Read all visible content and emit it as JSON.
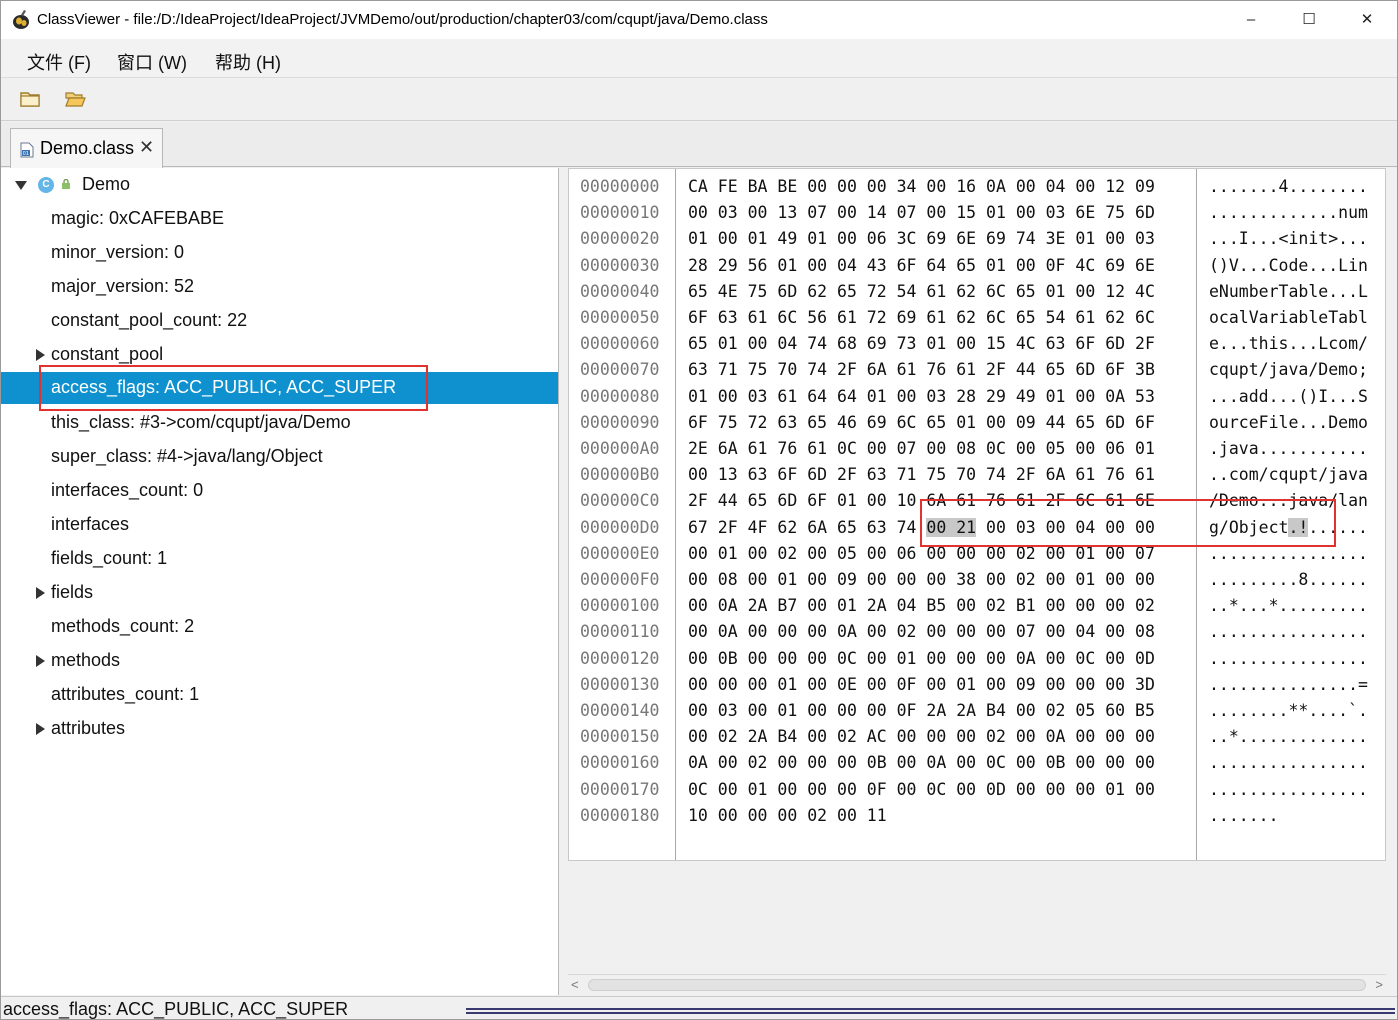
{
  "window": {
    "title": "ClassViewer - file:/D:/IdeaProject/IdeaProject/JVMDemo/out/production/chapter03/com/cqupt/java/Demo.class",
    "controls": {
      "minimize": "‒",
      "maximize": "☐",
      "close": "✕"
    }
  },
  "menu": [
    "文件 (F)",
    "窗口 (W)",
    "帮助 (H)"
  ],
  "toolbar": {
    "buttons": [
      "folder-icon",
      "open-folder-icon"
    ]
  },
  "tab": {
    "label": "Demo.class",
    "close": "✕"
  },
  "tree": {
    "root": "Demo",
    "items": [
      {
        "label": "magic: 0xCAFEBABE",
        "expandable": false
      },
      {
        "label": "minor_version: 0",
        "expandable": false
      },
      {
        "label": "major_version: 52",
        "expandable": false
      },
      {
        "label": "constant_pool_count: 22",
        "expandable": false
      },
      {
        "label": "constant_pool",
        "expandable": true
      },
      {
        "label": "access_flags: ACC_PUBLIC, ACC_SUPER",
        "expandable": false,
        "selected": true
      },
      {
        "label": "this_class: #3->com/cqupt/java/Demo",
        "expandable": false
      },
      {
        "label": "super_class: #4->java/lang/Object",
        "expandable": false
      },
      {
        "label": "interfaces_count: 0",
        "expandable": false
      },
      {
        "label": "interfaces",
        "expandable": false
      },
      {
        "label": "fields_count: 1",
        "expandable": false
      },
      {
        "label": "fields",
        "expandable": true
      },
      {
        "label": "methods_count: 2",
        "expandable": false
      },
      {
        "label": "methods",
        "expandable": true
      },
      {
        "label": "attributes_count: 1",
        "expandable": false
      },
      {
        "label": "attributes",
        "expandable": true
      }
    ]
  },
  "hex": {
    "rows": [
      {
        "offset": "00000000",
        "bytes": "CA FE BA BE 00 00 00 34 00 16 0A 00 04 00 12 09",
        "ascii": ".......4........"
      },
      {
        "offset": "00000010",
        "bytes": "00 03 00 13 07 00 14 07 00 15 01 00 03 6E 75 6D",
        "ascii": ".............num"
      },
      {
        "offset": "00000020",
        "bytes": "01 00 01 49 01 00 06 3C 69 6E 69 74 3E 01 00 03",
        "ascii": "...I...<init>..."
      },
      {
        "offset": "00000030",
        "bytes": "28 29 56 01 00 04 43 6F 64 65 01 00 0F 4C 69 6E",
        "ascii": "()V...Code...Lin"
      },
      {
        "offset": "00000040",
        "bytes": "65 4E 75 6D 62 65 72 54 61 62 6C 65 01 00 12 4C",
        "ascii": "eNumberTable...L"
      },
      {
        "offset": "00000050",
        "bytes": "6F 63 61 6C 56 61 72 69 61 62 6C 65 54 61 62 6C",
        "ascii": "ocalVariableTabl"
      },
      {
        "offset": "00000060",
        "bytes": "65 01 00 04 74 68 69 73 01 00 15 4C 63 6F 6D 2F",
        "ascii": "e...this...Lcom/"
      },
      {
        "offset": "00000070",
        "bytes": "63 71 75 70 74 2F 6A 61 76 61 2F 44 65 6D 6F 3B",
        "ascii": "cqupt/java/Demo;"
      },
      {
        "offset": "00000080",
        "bytes": "01 00 03 61 64 64 01 00 03 28 29 49 01 00 0A 53",
        "ascii": "...add...()I...S"
      },
      {
        "offset": "00000090",
        "bytes": "6F 75 72 63 65 46 69 6C 65 01 00 09 44 65 6D 6F",
        "ascii": "ourceFile...Demo"
      },
      {
        "offset": "000000A0",
        "bytes": "2E 6A 61 76 61 0C 00 07 00 08 0C 00 05 00 06 01",
        "ascii": ".java..........."
      },
      {
        "offset": "000000B0",
        "bytes": "00 13 63 6F 6D 2F 63 71 75 70 74 2F 6A 61 76 61",
        "ascii": "..com/cqupt/java"
      },
      {
        "offset": "000000C0",
        "bytes": "2F 44 65 6D 6F 01 00 10 6A 61 76 61 2F 6C 61 6E",
        "ascii": "/Demo...java/lan"
      },
      {
        "offset": "000000D0",
        "bytes_pre": "67 2F 4F 62 6A 65 63 74 ",
        "bytes_hl": "00 21",
        "bytes_post": " 00 03 00 04 00 00",
        "ascii_pre": "g/Object",
        "ascii_hl": ".!",
        "ascii_post": "......"
      },
      {
        "offset": "000000E0",
        "bytes": "00 01 00 02 00 05 00 06 00 00 00 02 00 01 00 07",
        "ascii": "................"
      },
      {
        "offset": "000000F0",
        "bytes": "00 08 00 01 00 09 00 00 00 38 00 02 00 01 00 00",
        "ascii": ".........8......"
      },
      {
        "offset": "00000100",
        "bytes": "00 0A 2A B7 00 01 2A 04 B5 00 02 B1 00 00 00 02",
        "ascii": "..*...*........."
      },
      {
        "offset": "00000110",
        "bytes": "00 0A 00 00 00 0A 00 02 00 00 00 07 00 04 00 08",
        "ascii": "................"
      },
      {
        "offset": "00000120",
        "bytes": "00 0B 00 00 00 0C 00 01 00 00 00 0A 00 0C 00 0D",
        "ascii": "................"
      },
      {
        "offset": "00000130",
        "bytes": "00 00 00 01 00 0E 00 0F 00 01 00 09 00 00 00 3D",
        "ascii": "...............="
      },
      {
        "offset": "00000140",
        "bytes": "00 03 00 01 00 00 00 0F 2A 2A B4 00 02 05 60 B5",
        "ascii": "........**....`."
      },
      {
        "offset": "00000150",
        "bytes": "00 02 2A B4 00 02 AC 00 00 00 02 00 0A 00 00 00",
        "ascii": "..*............."
      },
      {
        "offset": "00000160",
        "bytes": "0A 00 02 00 00 00 0B 00 0A 00 0C 00 0B 00 00 00",
        "ascii": "................"
      },
      {
        "offset": "00000170",
        "bytes": "0C 00 01 00 00 00 0F 00 0C 00 0D 00 00 00 01 00",
        "ascii": "................"
      },
      {
        "offset": "00000180",
        "bytes": "10 00 00 00 02 00 11",
        "ascii": "......."
      }
    ]
  },
  "scroll": {
    "left": "<",
    "right": ">"
  },
  "status": {
    "text": "access_flags: ACC_PUBLIC, ACC_SUPER"
  },
  "colors": {
    "selection": "#0f91cf",
    "annotation": "#e0322f",
    "highlight": "#c8c8c8"
  }
}
